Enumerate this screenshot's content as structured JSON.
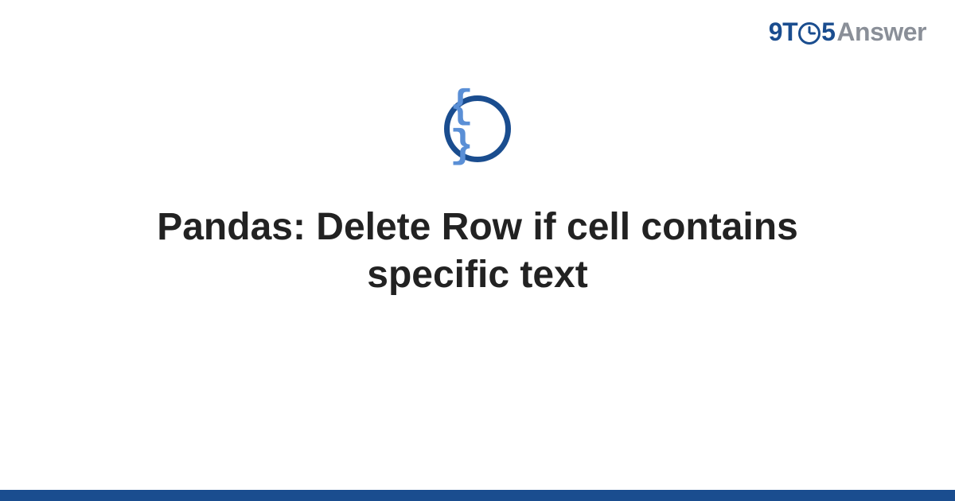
{
  "brand": {
    "prefix_nine": "9",
    "prefix_t": "T",
    "prefix_five": "5",
    "suffix": "Answer",
    "accent_color": "#1a4d8f",
    "muted_color": "#8a8f98"
  },
  "badge": {
    "glyph": "{ }",
    "name": "code-braces-icon"
  },
  "title": "Pandas: Delete Row if cell contains specific text"
}
